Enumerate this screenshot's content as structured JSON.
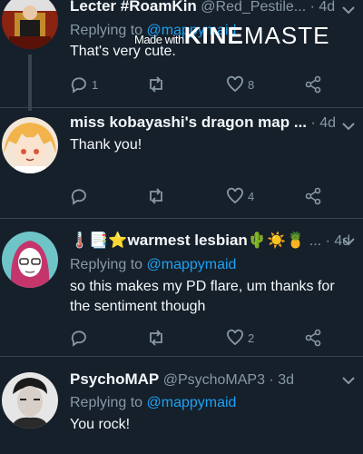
{
  "watermark": {
    "prefix": "Made with",
    "brand_bold": "KINE",
    "brand_rest": "MASTE"
  },
  "tweets": [
    {
      "name": "Lecter #RoamKin",
      "handle": "@Red_Pestile...",
      "time": "4d",
      "reply_prefix": "Replying to ",
      "reply_mention": "@mappymaid",
      "text": "That's very cute.",
      "replies": "1",
      "retweets": "",
      "likes": "8"
    },
    {
      "name": "miss kobayashi's dragon map ...",
      "handle": "",
      "time": "4d",
      "text": "Thank you!",
      "replies": "",
      "retweets": "",
      "likes": "4"
    },
    {
      "name_prefix": "🌡️📑",
      "name_star": "⭐",
      "name": "warmest lesbian",
      "name_suffix": "🌵☀️🍍",
      "handle": "...",
      "time": "4d",
      "reply_prefix": "Replying to ",
      "reply_mention": "@mappymaid",
      "text": "so this makes my PD flare, um thanks for the sentiment though",
      "replies": "",
      "retweets": "",
      "likes": "2"
    },
    {
      "name": "PsychoMAP",
      "handle": "@PsychoMAP3",
      "time": "3d",
      "reply_prefix": "Replying to ",
      "reply_mention": "@mappymaid",
      "text": "You rock!"
    }
  ],
  "colors": {
    "background": "#15202b",
    "muted": "#8899a6",
    "accent": "#1da1f2",
    "divider": "#38444d"
  }
}
